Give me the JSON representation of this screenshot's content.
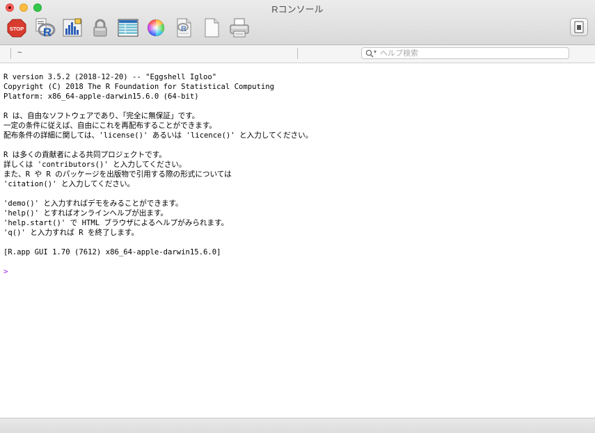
{
  "window": {
    "title": "Rコンソール"
  },
  "toolbar": {
    "items": [
      {
        "name": "stop-icon",
        "label": "STOP"
      },
      {
        "name": "r-source-icon"
      },
      {
        "name": "chart-icon"
      },
      {
        "name": "lock-icon"
      },
      {
        "name": "data-editor-icon"
      },
      {
        "name": "color-wheel-icon"
      },
      {
        "name": "r-document-icon"
      },
      {
        "name": "new-document-icon"
      },
      {
        "name": "print-icon"
      }
    ],
    "right_button": {
      "name": "toggle-drawer-icon"
    }
  },
  "pathbar": {
    "path": "~",
    "search_placeholder": "ヘルプ検索"
  },
  "console": {
    "lines": [
      "R version 3.5.2 (2018-12-20) -- \"Eggshell Igloo\"",
      "Copyright (C) 2018 The R Foundation for Statistical Computing",
      "Platform: x86_64-apple-darwin15.6.0 (64-bit)",
      "",
      "R は、自由なソフトウェアであり、「完全に無保証」です。",
      "一定の条件に従えば、自由にこれを再配布することができます。",
      "配布条件の詳細に関しては、'license()' あるいは 'licence()' と入力してください。",
      "",
      "R は多くの貢献者による共同プロジェクトです。",
      "詳しくは 'contributors()' と入力してください。",
      "また、R や R のパッケージを出版物で引用する際の形式については",
      "'citation()' と入力してください。",
      "",
      "'demo()' と入力すればデモをみることができます。",
      "'help()' とすればオンラインヘルプが出ます。",
      "'help.start()' で HTML ブラウザによるヘルプがみられます。",
      "'q()' と入力すれば R を終了します。",
      "",
      "[R.app GUI 1.70 (7612) x86_64-apple-darwin15.6.0]"
    ],
    "prompt": ">",
    "prompt_color": "#a020f0"
  }
}
